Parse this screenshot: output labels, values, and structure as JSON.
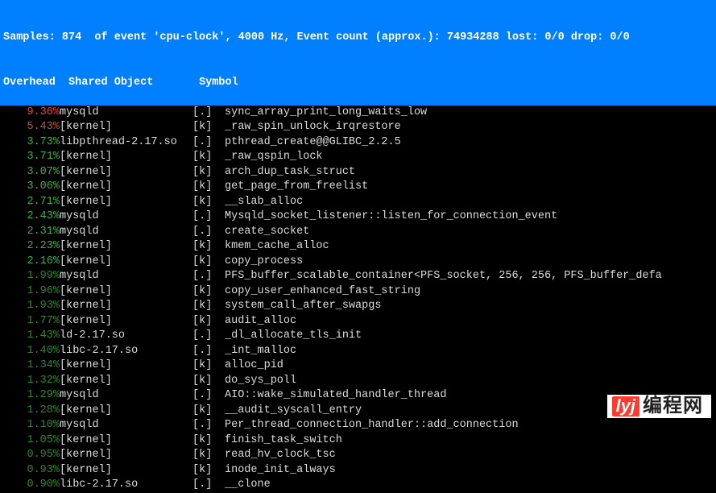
{
  "header": {
    "samples_line": "Samples: 874  of event 'cpu-clock', 4000 Hz, Event count (approx.): 74934288 lost: 0/0 drop: 0/0",
    "col_overhead": "Overhead",
    "col_shared": "Shared Object",
    "col_symbol": "Symbol"
  },
  "rows": [
    {
      "overhead": "9.36%",
      "color": "c-red",
      "shared": "mysqld",
      "flag": "[.]",
      "symbol": "sync_array_print_long_waits_low"
    },
    {
      "overhead": "5.43%",
      "color": "c-brown",
      "shared": "[kernel]",
      "flag": "[k]",
      "symbol": "_raw_spin_unlock_irqrestore"
    },
    {
      "overhead": "3.73%",
      "color": "c-green1",
      "shared": "libpthread-2.17.so",
      "flag": "[.]",
      "symbol": "pthread_create@@GLIBC_2.2.5"
    },
    {
      "overhead": "3.71%",
      "color": "c-green1",
      "shared": "[kernel]",
      "flag": "[k]",
      "symbol": "_raw_qspin_lock"
    },
    {
      "overhead": "3.07%",
      "color": "c-green1",
      "shared": "[kernel]",
      "flag": "[k]",
      "symbol": "arch_dup_task_struct"
    },
    {
      "overhead": "3.06%",
      "color": "c-green1",
      "shared": "[kernel]",
      "flag": "[k]",
      "symbol": "get_page_from_freelist"
    },
    {
      "overhead": "2.71%",
      "color": "c-green1",
      "shared": "[kernel]",
      "flag": "[k]",
      "symbol": "__slab_alloc"
    },
    {
      "overhead": "2.43%",
      "color": "c-green1",
      "shared": "mysqld",
      "flag": "[.]",
      "symbol": "Mysqld_socket_listener::listen_for_connection_event"
    },
    {
      "overhead": "2.31%",
      "color": "c-green1",
      "shared": "mysqld",
      "flag": "[.]",
      "symbol": "create_socket"
    },
    {
      "overhead": "2.23%",
      "color": "c-green1",
      "shared": "[kernel]",
      "flag": "[k]",
      "symbol": "kmem_cache_alloc"
    },
    {
      "overhead": "2.16%",
      "color": "c-green1",
      "shared": "[kernel]",
      "flag": "[k]",
      "symbol": "copy_process"
    },
    {
      "overhead": "1.99%",
      "color": "c-green2",
      "shared": "mysqld",
      "flag": "[.]",
      "symbol": "PFS_buffer_scalable_container<PFS_socket, 256, 256, PFS_buffer_defa"
    },
    {
      "overhead": "1.96%",
      "color": "c-green2",
      "shared": "[kernel]",
      "flag": "[k]",
      "symbol": "copy_user_enhanced_fast_string"
    },
    {
      "overhead": "1.93%",
      "color": "c-green2",
      "shared": "[kernel]",
      "flag": "[k]",
      "symbol": "system_call_after_swapgs"
    },
    {
      "overhead": "1.77%",
      "color": "c-green2",
      "shared": "[kernel]",
      "flag": "[k]",
      "symbol": "audit_alloc"
    },
    {
      "overhead": "1.43%",
      "color": "c-green2",
      "shared": "ld-2.17.so",
      "flag": "[.]",
      "symbol": "_dl_allocate_tls_init"
    },
    {
      "overhead": "1.40%",
      "color": "c-green2",
      "shared": "libc-2.17.so",
      "flag": "[.]",
      "symbol": "_int_malloc"
    },
    {
      "overhead": "1.34%",
      "color": "c-green2",
      "shared": "[kernel]",
      "flag": "[k]",
      "symbol": "alloc_pid"
    },
    {
      "overhead": "1.32%",
      "color": "c-green2",
      "shared": "[kernel]",
      "flag": "[k]",
      "symbol": "do_sys_poll"
    },
    {
      "overhead": "1.29%",
      "color": "c-green2",
      "shared": "mysqld",
      "flag": "[.]",
      "symbol": "AIO::wake_simulated_handler_thread"
    },
    {
      "overhead": "1.28%",
      "color": "c-green2",
      "shared": "[kernel]",
      "flag": "[k]",
      "symbol": "__audit_syscall_entry"
    },
    {
      "overhead": "1.10%",
      "color": "c-green2",
      "shared": "mysqld",
      "flag": "[.]",
      "symbol": "Per_thread_connection_handler::add_connection"
    },
    {
      "overhead": "1.05%",
      "color": "c-green2",
      "shared": "[kernel]",
      "flag": "[k]",
      "symbol": "finish_task_switch"
    },
    {
      "overhead": "0.95%",
      "color": "c-green2",
      "shared": "[kernel]",
      "flag": "[k]",
      "symbol": "read_hv_clock_tsc"
    },
    {
      "overhead": "0.93%",
      "color": "c-green2",
      "shared": "[kernel]",
      "flag": "[k]",
      "symbol": "inode_init_always"
    },
    {
      "overhead": "0.90%",
      "color": "c-green2",
      "shared": "libc-2.17.so",
      "flag": "[.]",
      "symbol": "__clone"
    }
  ],
  "watermark": {
    "logo": "lyj",
    "text": "编程网"
  }
}
